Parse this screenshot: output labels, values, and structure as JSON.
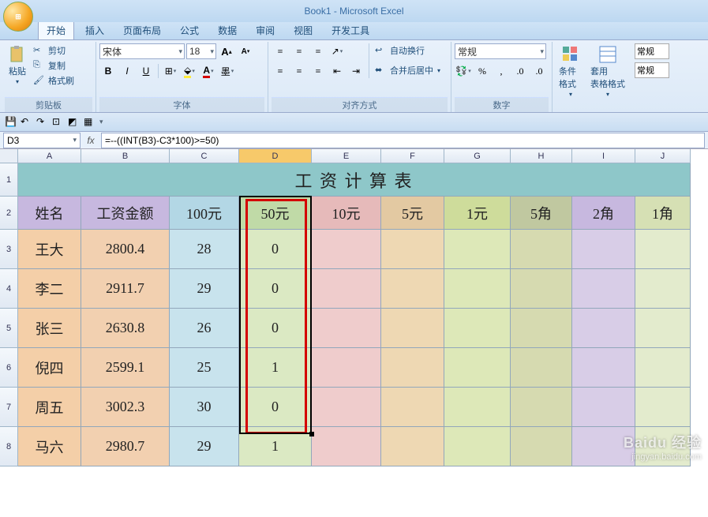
{
  "app": {
    "title": "Book1 - Microsoft Excel"
  },
  "tabs": [
    "开始",
    "插入",
    "页面布局",
    "公式",
    "数据",
    "审阅",
    "视图",
    "开发工具"
  ],
  "active_tab": 0,
  "ribbon": {
    "clipboard": {
      "label": "剪贴板",
      "paste": "粘贴",
      "cut": "剪切",
      "copy": "复制",
      "painter": "格式刷"
    },
    "font": {
      "label": "字体",
      "name": "宋体",
      "size": "18",
      "inc": "A",
      "dec": "A"
    },
    "align": {
      "label": "对齐方式",
      "wrap": "自动换行",
      "merge": "合并后居中"
    },
    "number": {
      "label": "数字",
      "format": "常规"
    },
    "styles_group": {
      "cond": "条件格式",
      "table": "套用\n表格格式"
    },
    "styles": [
      "常规",
      "常规"
    ]
  },
  "namebox": "D3",
  "formula": "=--((INT(B3)-C3*100)>=50)",
  "columns": [
    "A",
    "B",
    "C",
    "D",
    "E",
    "F",
    "G",
    "H",
    "I",
    "J"
  ],
  "col_widths": [
    "wA",
    "wB",
    "wC",
    "wD",
    "wE",
    "wF",
    "wG",
    "wH",
    "wI",
    "wJ"
  ],
  "title_row": {
    "num": "1",
    "text": "工 资 计 算 表",
    "bg": "#8ec7c9"
  },
  "header_row": {
    "num": "2",
    "cells": [
      {
        "t": "姓名",
        "bg": "#c7b8df"
      },
      {
        "t": "工资金额",
        "bg": "#c7b8df"
      },
      {
        "t": "100元",
        "bg": "#b3d7e5"
      },
      {
        "t": "50元",
        "bg": "#c0daa7"
      },
      {
        "t": "10元",
        "bg": "#e6baba"
      },
      {
        "t": "5元",
        "bg": "#e3c9a2"
      },
      {
        "t": "1元",
        "bg": "#cedc9b"
      },
      {
        "t": "5角",
        "bg": "#c0c8a0"
      },
      {
        "t": "2角",
        "bg": "#c7b8df"
      },
      {
        "t": "1角",
        "bg": "#d6e0b4"
      }
    ]
  },
  "data_bg": [
    "#f4cfa8",
    "#f2d0b0",
    "#c8e3ed",
    "#dbe9c3",
    "#efcccc",
    "#eed8b3",
    "#dde8b8",
    "#d6dab0",
    "#d8cde7",
    "#e3ebcd"
  ],
  "data_rows": [
    {
      "num": "3",
      "cells": [
        "王大",
        "2800.4",
        "28",
        "0",
        "",
        "",
        "",
        "",
        "",
        ""
      ]
    },
    {
      "num": "4",
      "cells": [
        "李二",
        "2911.7",
        "29",
        "0",
        "",
        "",
        "",
        "",
        "",
        ""
      ]
    },
    {
      "num": "5",
      "cells": [
        "张三",
        "2630.8",
        "26",
        "0",
        "",
        "",
        "",
        "",
        "",
        ""
      ]
    },
    {
      "num": "6",
      "cells": [
        "倪四",
        "2599.1",
        "25",
        "1",
        "",
        "",
        "",
        "",
        "",
        ""
      ]
    },
    {
      "num": "7",
      "cells": [
        "周五",
        "3002.3",
        "30",
        "0",
        "",
        "",
        "",
        "",
        "",
        ""
      ]
    },
    {
      "num": "8",
      "cells": [
        "马六",
        "2980.7",
        "29",
        "1",
        "",
        "",
        "",
        "",
        "",
        ""
      ]
    }
  ],
  "selected_col_index": 3,
  "watermark": {
    "brand": "Baidu 经验",
    "url": "jingyan.baidu.com"
  }
}
